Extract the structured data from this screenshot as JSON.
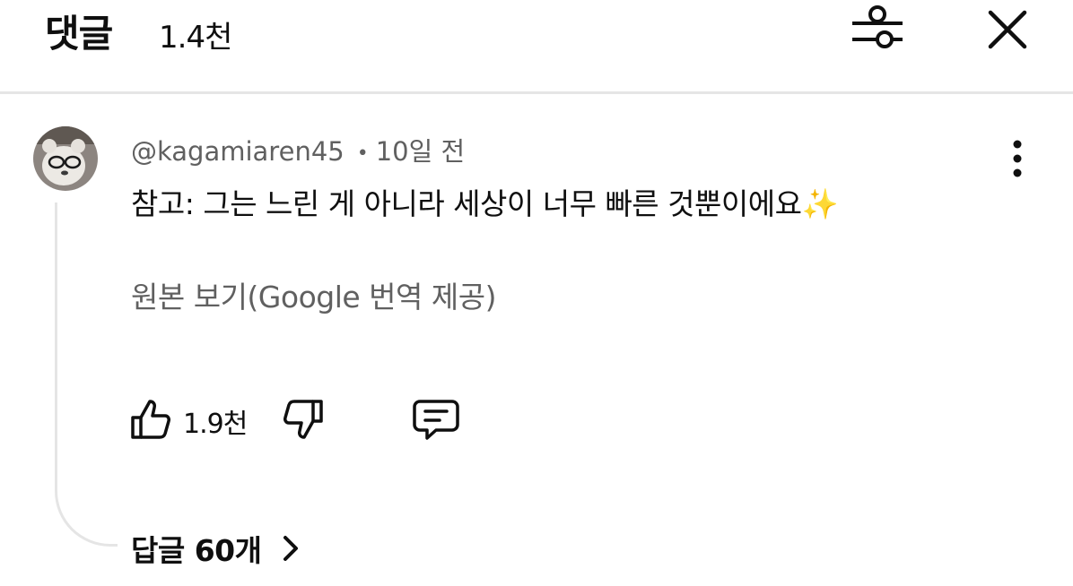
{
  "header": {
    "title": "댓글",
    "count": "1.4천",
    "filter_icon": "filter-sliders-icon",
    "close_icon": "close-icon"
  },
  "comment": {
    "author": "@kagamiaren45",
    "separator": "•",
    "time": "10일 전",
    "text": "참고: 그는 느린 게 아니라 세상이 너무 빠른 것뿐이에요",
    "emoji": "✨",
    "translate_label": "원본 보기(Google 번역 제공)",
    "avatar_icon": "avatar-image",
    "more_icon": "more-vertical-icon"
  },
  "actions": {
    "like_count": "1.9천",
    "like_icon": "thumbs-up-icon",
    "dislike_icon": "thumbs-down-icon",
    "reply_icon": "comment-reply-icon"
  },
  "replies": {
    "label": "답글 60개",
    "chevron_icon": "chevron-right-icon"
  },
  "colors": {
    "text_primary": "#0f0f0f",
    "text_secondary": "#606060",
    "divider": "#e5e5e5",
    "background": "#ffffff"
  }
}
